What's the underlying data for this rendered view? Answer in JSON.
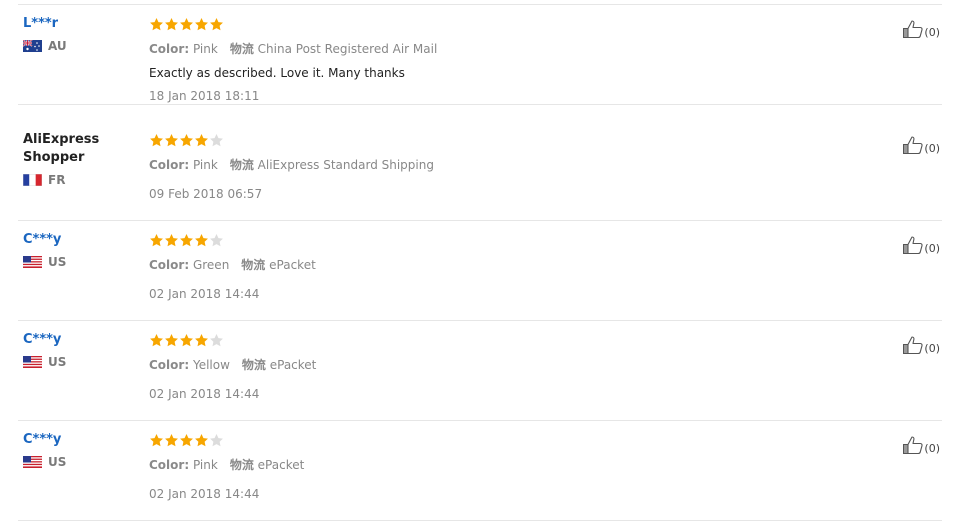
{
  "labels": {
    "color": "Color:",
    "shipping": "物流"
  },
  "colors": {
    "star_filled": "#f7a600",
    "star_empty": "#dcdcdc",
    "name_masked": "#1a66c0"
  },
  "reviews": [
    {
      "user": "L***r",
      "masked": true,
      "country": "AU",
      "flag": "flag-au-icon",
      "stars": 5,
      "color": "Pink",
      "shipping": "China Post Registered Air Mail",
      "comment": "Exactly as described. Love it. Many thanks",
      "date": "18 Jan 2018 18:11",
      "likes": "(0)"
    },
    {
      "user": "AliExpress Shopper",
      "masked": false,
      "country": "FR",
      "flag": "flag-fr-icon",
      "stars": 4,
      "color": "Pink",
      "shipping": "AliExpress Standard Shipping",
      "comment": "",
      "date": "09 Feb 2018 06:57",
      "likes": "(0)"
    },
    {
      "user": "C***y",
      "masked": true,
      "country": "US",
      "flag": "flag-us-icon",
      "stars": 4,
      "color": "Green",
      "shipping": "ePacket",
      "comment": "",
      "date": "02 Jan 2018 14:44",
      "likes": "(0)"
    },
    {
      "user": "C***y",
      "masked": true,
      "country": "US",
      "flag": "flag-us-icon",
      "stars": 4,
      "color": "Yellow",
      "shipping": "ePacket",
      "comment": "",
      "date": "02 Jan 2018 14:44",
      "likes": "(0)"
    },
    {
      "user": "C***y",
      "masked": true,
      "country": "US",
      "flag": "flag-us-icon",
      "stars": 4,
      "color": "Pink",
      "shipping": "ePacket",
      "comment": "",
      "date": "02 Jan 2018 14:44",
      "likes": "(0)"
    }
  ]
}
